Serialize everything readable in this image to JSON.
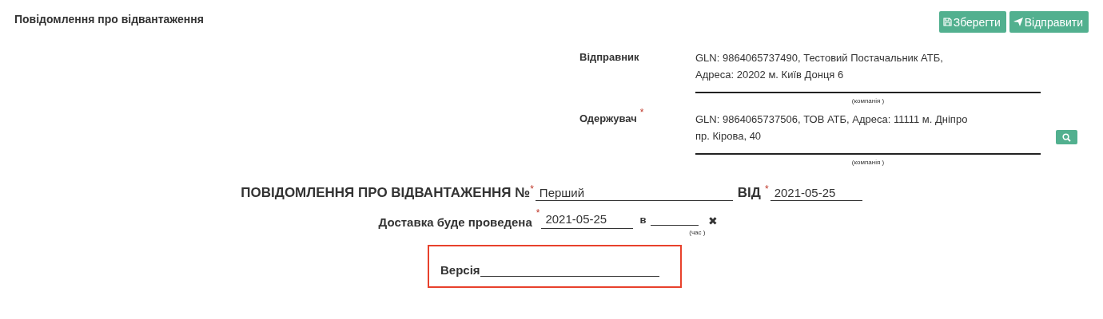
{
  "header": {
    "title": "Повідомлення про відвантаження",
    "buttons": [
      {
        "kind": "save",
        "label": "Зберегти"
      },
      {
        "kind": "send",
        "label": "Відправити"
      }
    ]
  },
  "parties": [
    {
      "label": "Відправник",
      "value": [
        "GLN: 9864065737490, Тестовий Постачальник АТБ,",
        "Адреса: 20202 м. Київ Донця 6"
      ],
      "caption": "(компанія )"
    },
    {
      "label": "Одержувач",
      "required_mark": "*",
      "value": [
        "GLN: 9864065737506, ТОВ АТБ, Адреса: 11111 м. Дніпро",
        "пр. Кірова, 40"
      ],
      "caption": "(компанія )",
      "search": true
    }
  ],
  "number_line": {
    "label": "ПОВІДОМЛЕННЯ ПРО ВІДВАНТАЖЕННЯ №",
    "required_mark": "*",
    "value": "Перший",
    "date_label": "ВІД",
    "date_required_mark": "*",
    "date": "2021-05-25"
  },
  "delivery": {
    "label": "Доставка буде проведена",
    "required_mark": "*",
    "date": "2021-05-25",
    "time_label": "в",
    "time_caption": "(час )",
    "clear": "✖"
  },
  "version": {
    "label": "Версія",
    "highlighted": true
  }
}
